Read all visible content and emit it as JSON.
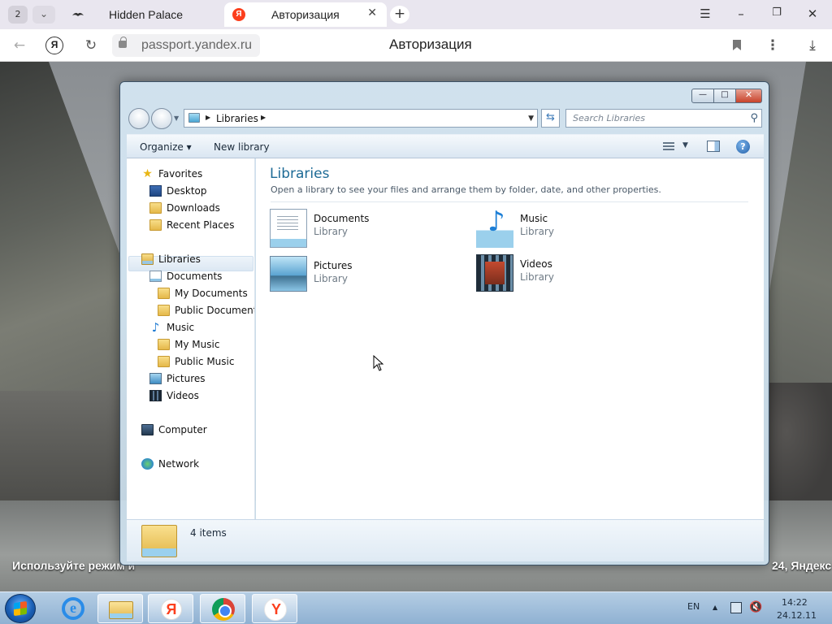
{
  "browser": {
    "tab_count": "2",
    "tabs": [
      {
        "title": "Hidden Palace",
        "active": false
      },
      {
        "title": "Авторизация",
        "active": true,
        "favicon": "Я"
      }
    ],
    "address": {
      "url": "passport.yandex.ru",
      "page_title": "Авторизация",
      "profile_badge": "Я"
    },
    "icons": [
      "back-icon",
      "reload-icon",
      "lock-icon",
      "bookmark-icon",
      "menu-dots-icon",
      "download-icon",
      "new-tab-icon",
      "minimize-icon",
      "restore-icon",
      "close-icon",
      "tab-menu-icon"
    ]
  },
  "explorer": {
    "address": {
      "crumb": "Libraries"
    },
    "search": {
      "placeholder": "Search Libraries"
    },
    "toolbar": {
      "organize": "Organize",
      "new_library": "New library",
      "help": "?"
    },
    "nav": {
      "favorites": "Favorites",
      "desktop": "Desktop",
      "downloads": "Downloads",
      "recent_places": "Recent Places",
      "libraries": "Libraries",
      "documents": "Documents",
      "my_documents": "My Documents",
      "public_documents": "Public Documents",
      "music": "Music",
      "my_music": "My Music",
      "public_music": "Public Music",
      "pictures": "Pictures",
      "videos": "Videos",
      "computer": "Computer",
      "network": "Network"
    },
    "content": {
      "title": "Libraries",
      "description": "Open a library to see your files and arrange them by folder, date, and other properties.",
      "libraries": [
        {
          "name": "Documents",
          "type": "Library",
          "icon": "documents-library-icon"
        },
        {
          "name": "Music",
          "type": "Library",
          "icon": "music-library-icon"
        },
        {
          "name": "Pictures",
          "type": "Library",
          "icon": "pictures-library-icon"
        },
        {
          "name": "Videos",
          "type": "Library",
          "icon": "videos-library-icon"
        }
      ]
    },
    "details": {
      "count": "4 items"
    }
  },
  "desktop_footer": {
    "left": "Используйте режим и",
    "right": "24, Яндекс"
  },
  "taskbar": {
    "language": "EN",
    "time": "14:22",
    "date": "24.12.11"
  }
}
